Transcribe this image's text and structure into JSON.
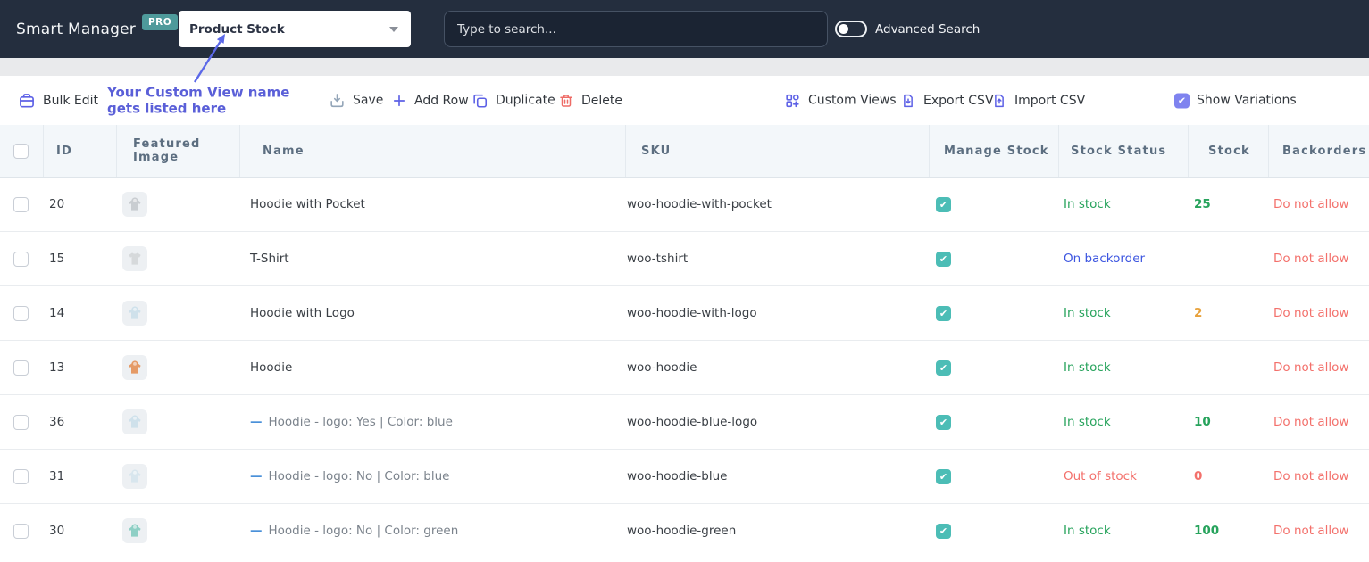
{
  "topbar": {
    "brand": "Smart Manager",
    "pro_badge": "PRO",
    "view_dropdown_value": "Product Stock",
    "search_placeholder": "Type to search...",
    "advanced_search_label": "Advanced Search"
  },
  "toolbar": {
    "bulk_edit": "Bulk Edit",
    "annotation_line1": "Your Custom View name",
    "annotation_line2": "gets listed here",
    "save": "Save",
    "add_row": "Add Row",
    "duplicate": "Duplicate",
    "delete": "Delete",
    "custom_views": "Custom Views",
    "export_csv": "Export CSV",
    "import_csv": "Import CSV",
    "show_variations": "Show Variations"
  },
  "colors": {
    "accent_purple": "#5d61e6",
    "annotation_purple": "#5a5fd8",
    "teal_checkbox": "#4cbdb6",
    "green": "#27a35c",
    "orange": "#e8a23c",
    "red": "#f3706b",
    "blue": "#3d56e0",
    "topbar_bg": "#242e3e",
    "pro_badge_bg": "#4e9a9b",
    "header_bg": "#f3f7fa"
  },
  "table": {
    "columns": [
      "ID",
      "Featured Image",
      "Name",
      "SKU",
      "Manage Stock",
      "Stock Status",
      "Stock",
      "Backorders"
    ],
    "rows": [
      {
        "id": "20",
        "thumb": {
          "type": "hoodie",
          "color": "#c9cdd1"
        },
        "name": "Hoodie with Pocket",
        "variation": false,
        "sku": "woo-hoodie-with-pocket",
        "manage_stock": true,
        "status": "In stock",
        "status_color": "green",
        "stock": "25",
        "stock_color": "green",
        "backorders": "Do not allow"
      },
      {
        "id": "15",
        "thumb": {
          "type": "tshirt",
          "color": "#d6d9db"
        },
        "name": "T-Shirt",
        "variation": false,
        "sku": "woo-tshirt",
        "manage_stock": true,
        "status": "On backorder",
        "status_color": "blue",
        "stock": "",
        "stock_color": "green",
        "backorders": "Do not allow"
      },
      {
        "id": "14",
        "thumb": {
          "type": "hoodie",
          "color": "#cfe1eb"
        },
        "name": "Hoodie with Logo",
        "variation": false,
        "sku": "woo-hoodie-with-logo",
        "manage_stock": true,
        "status": "In stock",
        "status_color": "green",
        "stock": "2",
        "stock_color": "orange",
        "backorders": "Do not allow"
      },
      {
        "id": "13",
        "thumb": {
          "type": "hoodie",
          "color": "#e59a66"
        },
        "name": "Hoodie",
        "variation": false,
        "sku": "woo-hoodie",
        "manage_stock": true,
        "status": "In stock",
        "status_color": "green",
        "stock": "",
        "stock_color": "green",
        "backorders": "Do not allow"
      },
      {
        "id": "36",
        "thumb": {
          "type": "hoodie",
          "color": "#cfe1eb"
        },
        "name": "Hoodie - logo: Yes | Color: blue",
        "variation": true,
        "sku": "woo-hoodie-blue-logo",
        "manage_stock": true,
        "status": "In stock",
        "status_color": "green",
        "stock": "10",
        "stock_color": "green",
        "backorders": "Do not allow"
      },
      {
        "id": "31",
        "thumb": {
          "type": "hoodie",
          "color": "#d8e6ee"
        },
        "name": "Hoodie - logo: No | Color: blue",
        "variation": true,
        "sku": "woo-hoodie-blue",
        "manage_stock": true,
        "status": "Out of stock",
        "status_color": "red",
        "stock": "0",
        "stock_color": "red",
        "backorders": "Do not allow"
      },
      {
        "id": "30",
        "thumb": {
          "type": "hoodie",
          "color": "#8ecfc5"
        },
        "name": "Hoodie - logo: No | Color: green",
        "variation": true,
        "sku": "woo-hoodie-green",
        "manage_stock": true,
        "status": "In stock",
        "status_color": "green",
        "stock": "100",
        "stock_color": "green",
        "backorders": "Do not allow"
      }
    ]
  }
}
